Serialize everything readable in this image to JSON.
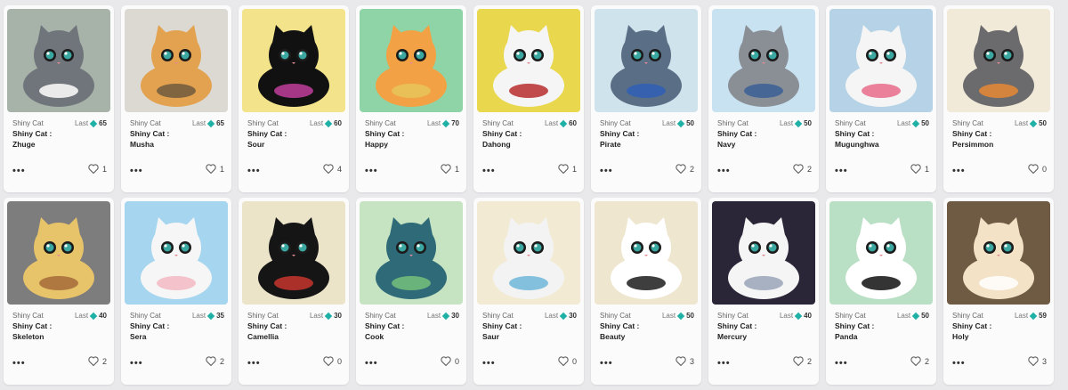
{
  "cards": [
    {
      "collection": "Shiny Cat",
      "last_label": "Last",
      "last_value": "65",
      "prefix": "Shiny Cat :",
      "name": "Zhuge",
      "likes": "1",
      "bg": "#a7b3a8",
      "body": "#70757c",
      "accent": "#ffffff"
    },
    {
      "collection": "Shiny Cat",
      "last_label": "Last",
      "last_value": "65",
      "prefix": "Shiny Cat :",
      "name": "Musha",
      "likes": "1",
      "bg": "#dcd9d2",
      "body": "#e3a24f",
      "accent": "#6e5b3d"
    },
    {
      "collection": "Shiny Cat",
      "last_label": "Last",
      "last_value": "60",
      "prefix": "Shiny Cat :",
      "name": "Sour",
      "likes": "4",
      "bg": "#f3e38a",
      "body": "#111111",
      "accent": "#c13e9b"
    },
    {
      "collection": "Shiny Cat",
      "last_label": "Last",
      "last_value": "70",
      "prefix": "Shiny Cat :",
      "name": "Happy",
      "likes": "1",
      "bg": "#8fd4a7",
      "body": "#f2a244",
      "accent": "#e8c45a"
    },
    {
      "collection": "Shiny Cat",
      "last_label": "Last",
      "last_value": "60",
      "prefix": "Shiny Cat :",
      "name": "Dahong",
      "likes": "1",
      "bg": "#e9d74d",
      "body": "#f5f5f5",
      "accent": "#b72b2b"
    },
    {
      "collection": "Shiny Cat",
      "last_label": "Last",
      "last_value": "50",
      "prefix": "Shiny Cat :",
      "name": "Pirate",
      "likes": "2",
      "bg": "#cfe3ec",
      "body": "#5a6f86",
      "accent": "#2f5fb6"
    },
    {
      "collection": "Shiny Cat",
      "last_label": "Last",
      "last_value": "50",
      "prefix": "Shiny Cat :",
      "name": "Navy",
      "likes": "2",
      "bg": "#c9e2f2",
      "body": "#8a8f96",
      "accent": "#3a5f96"
    },
    {
      "collection": "Shiny Cat",
      "last_label": "Last",
      "last_value": "50",
      "prefix": "Shiny Cat :",
      "name": "Mugunghwa",
      "likes": "1",
      "bg": "#b6d2e6",
      "body": "#f5f5f5",
      "accent": "#e86b8a"
    },
    {
      "collection": "Shiny Cat",
      "last_label": "Last",
      "last_value": "50",
      "prefix": "Shiny Cat :",
      "name": "Persimmon",
      "likes": "0",
      "bg": "#f1ead9",
      "body": "#6b6a6c",
      "accent": "#e88835"
    },
    {
      "collection": "Shiny Cat",
      "last_label": "Last",
      "last_value": "40",
      "prefix": "Shiny Cat :",
      "name": "Skeleton",
      "likes": "2",
      "bg": "#7d7d7d",
      "body": "#e7c36a",
      "accent": "#a46b3a"
    },
    {
      "collection": "Shiny Cat",
      "last_label": "Last",
      "last_value": "35",
      "prefix": "Shiny Cat :",
      "name": "Sera",
      "likes": "2",
      "bg": "#a6d6ef",
      "body": "#f6f6f6",
      "accent": "#f2b8c3"
    },
    {
      "collection": "Shiny Cat",
      "last_label": "Last",
      "last_value": "30",
      "prefix": "Shiny Cat :",
      "name": "Camellia",
      "likes": "0",
      "bg": "#ece4c9",
      "body": "#151515",
      "accent": "#c7352e"
    },
    {
      "collection": "Shiny Cat",
      "last_label": "Last",
      "last_value": "30",
      "prefix": "Shiny Cat :",
      "name": "Cook",
      "likes": "0",
      "bg": "#c6e3c2",
      "body": "#2f6a78",
      "accent": "#74c07a"
    },
    {
      "collection": "Shiny Cat",
      "last_label": "Last",
      "last_value": "30",
      "prefix": "Shiny Cat :",
      "name": "Saur",
      "likes": "0",
      "bg": "#f2ead2",
      "body": "#f3f3f3",
      "accent": "#6fb6d8"
    },
    {
      "collection": "Shiny Cat",
      "last_label": "Last",
      "last_value": "50",
      "prefix": "Shiny Cat :",
      "name": "Beauty",
      "likes": "3",
      "bg": "#efe6d0",
      "body": "#ffffff",
      "accent": "#1c1c1c"
    },
    {
      "collection": "Shiny Cat",
      "last_label": "Last",
      "last_value": "40",
      "prefix": "Shiny Cat :",
      "name": "Mercury",
      "likes": "2",
      "bg": "#2b2538",
      "body": "#f5f5f5",
      "accent": "#9aa4b8"
    },
    {
      "collection": "Shiny Cat",
      "last_label": "Last",
      "last_value": "50",
      "prefix": "Shiny Cat :",
      "name": "Panda",
      "likes": "2",
      "bg": "#b9dfc4",
      "body": "#ffffff",
      "accent": "#111111"
    },
    {
      "collection": "Shiny Cat",
      "last_label": "Last",
      "last_value": "59",
      "prefix": "Shiny Cat :",
      "name": "Holy",
      "likes": "3",
      "bg": "#6f5a43",
      "body": "#f3e2c6",
      "accent": "#ffffff"
    }
  ]
}
